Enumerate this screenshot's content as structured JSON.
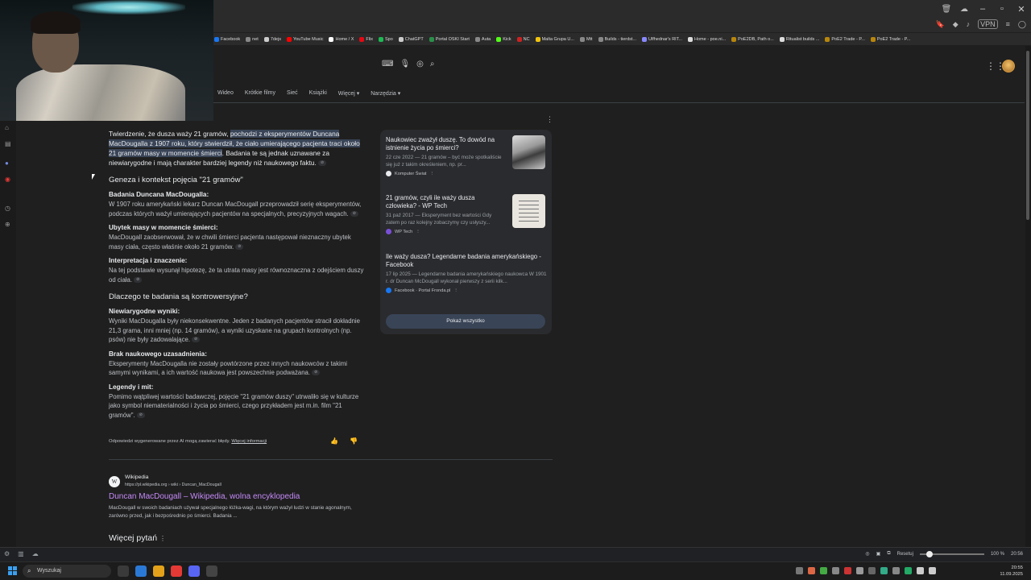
{
  "bookmarks": [
    {
      "label": "Facebook",
      "color": "#1877f2"
    },
    {
      "label": "net",
      "color": "#888888"
    },
    {
      "label": "7dejs",
      "color": "#cccccc"
    },
    {
      "label": "YouTube Music",
      "color": "#ff0000"
    },
    {
      "label": "Home / X",
      "color": "#ffffff"
    },
    {
      "label": "Flix",
      "color": "#e50914"
    },
    {
      "label": "Spo",
      "color": "#1db954"
    },
    {
      "label": "ChatGPT",
      "color": "#cccccc"
    },
    {
      "label": "Portal OSKI Start",
      "color": "#2a8f4a"
    },
    {
      "label": "Auta",
      "color": "#888888"
    },
    {
      "label": "Kick",
      "color": "#53fc18"
    },
    {
      "label": "NC",
      "color": "#cc2222"
    },
    {
      "label": "Malta Grupa U...",
      "color": "#f1c40f"
    },
    {
      "label": "Mtt",
      "color": "#888888"
    },
    {
      "label": "Builds - tierdst...",
      "color": "#888888"
    },
    {
      "label": "Ulfhednar's RIT...",
      "color": "#8888ff"
    },
    {
      "label": "Home - poe.ni...",
      "color": "#dddddd"
    },
    {
      "label": "PoE2DB, Path o...",
      "color": "#b8860b"
    },
    {
      "label": "Ritualist builds ...",
      "color": "#dddddd"
    },
    {
      "label": "PoE2 Trade - P...",
      "color": "#b8860b"
    },
    {
      "label": "PoE2 Trade - P...",
      "color": "#b8860b"
    }
  ],
  "nav_tabs": [
    "Wideo",
    "Krótkie filmy",
    "Sieć",
    "Książki",
    "Więcej ▾",
    "Narzędzia ▾"
  ],
  "ai": {
    "intro_a": "Twierdzenie, że dusza waży 21 gramów, ",
    "intro_hl": "pochodzi z eksperymentów Duncana MacDougalla z 1907 roku, który stwierdził, że ciało umierającego pacjenta traci około 21 gramów masy w momencie śmierci",
    "intro_b": ". Badania te są jednak uznawane za niewiarygodne i mają charakter bardziej legendy niż naukowego faktu.",
    "h_geneza": "Geneza i kontekst pojęcia \"21 gramów\"",
    "h_badania": "Badania Duncana MacDougalla:",
    "t_badania": "W 1907 roku amerykański lekarz Duncan MacDougall przeprowadził serię eksperymentów, podczas których ważył umierających pacjentów na specjalnych, precyzyjnych wagach.",
    "h_ubytek": "Ubytek masy w momencie śmierci:",
    "t_ubytek": "MacDougall zaobserwował, że w chwili śmierci pacjenta następował nieznaczny ubytek masy ciała, często właśnie około 21 gramów.",
    "h_interpretacja": "Interpretacja i znaczenie:",
    "t_interpretacja": "Na tej podstawie wysunął hipotezę, że ta utrata masy jest równoznaczna z odejściem duszy od ciała.",
    "h_dlaczego": "Dlaczego te badania są kontrowersyjne?",
    "h_niewiarygodne": "Niewiarygodne wyniki:",
    "t_niewiarygodne": "Wyniki MacDougalla były niekonsekwentne. Jeden z badanych pacjentów stracił dokładnie 21,3 grama, inni mniej (np. 14 gramów), a wyniki uzyskane na grupach kontrolnych (np. psów) nie były zadowalające.",
    "h_brak": "Brak naukowego uzasadnienia:",
    "t_brak": "Eksperymenty MacDougalla nie zostały powtórzone przez innych naukowców z takimi samymi wynikami, a ich wartość naukowa jest powszechnie podważana.",
    "h_legendy": "Legendy i mit:",
    "t_legendy": "Pomimo wątpliwej wartości badawczej, pojęcie \"21 gramów duszy\" utrwaliło się w kulturze jako symbol niematerialności i życia po śmierci, czego przykładem jest m.in. film \"21 gramów\".",
    "note_a": "Odpowiedzi wygenerowane przez AI mogą zawierać błędy. ",
    "note_link": "Więcej informacji"
  },
  "cards": [
    {
      "title": "Naukowiec zważył duszę. To dowód na istnienie życia po śmierci?",
      "snippet": "22 cze 2022 — 21 gramów – być może spotkaliście się już z takim określeniem, np. pr...",
      "source": "Komputer Świat",
      "src_color": "#e8eaed"
    },
    {
      "title": "21 gramów, czyli ile waży dusza człowieka? - WP Tech",
      "snippet": "31 paź 2017 — Eksperyment bez wartości Gdy zatem po raz kolejny zobaczymy czy usłyszy...",
      "source": "WP Tech",
      "src_color": "#7a4fd8"
    },
    {
      "title": "Ile waży dusza? Legendarne badania amerykańskiego - Facebook",
      "snippet": "17 lip 2025 — Legendarne badania amerykańskiego naukowca W 1901 r. dr Duncan McDougall wykonał pierwszy z serii kilk...",
      "source": "Facebook · Portal Fronda.pl",
      "src_color": "#1877f2"
    }
  ],
  "show_all": "Pokaż wszystko",
  "wiki": {
    "name": "Wikipedia",
    "url": "https://pl.wikipedia.org › wiki › Duncan_MacDougall",
    "title": "Duncan MacDougall – Wikipedia, wolna encyklopedia",
    "snippet": "MacDougall w swoich badaniach używał specjalnego łóżka-wagi, na którym ważył ludzi w stanie agonalnym, zarówno przed, jak i bezpośrednio po śmierci. Badania ..."
  },
  "more_questions": "Więcej pytań",
  "status": {
    "reset": "Resetuj",
    "zoom": "100 %",
    "time": "20:56"
  },
  "taskbar": {
    "search": "Wyszukaj",
    "time": "20:55",
    "date": "11.09.2025"
  }
}
